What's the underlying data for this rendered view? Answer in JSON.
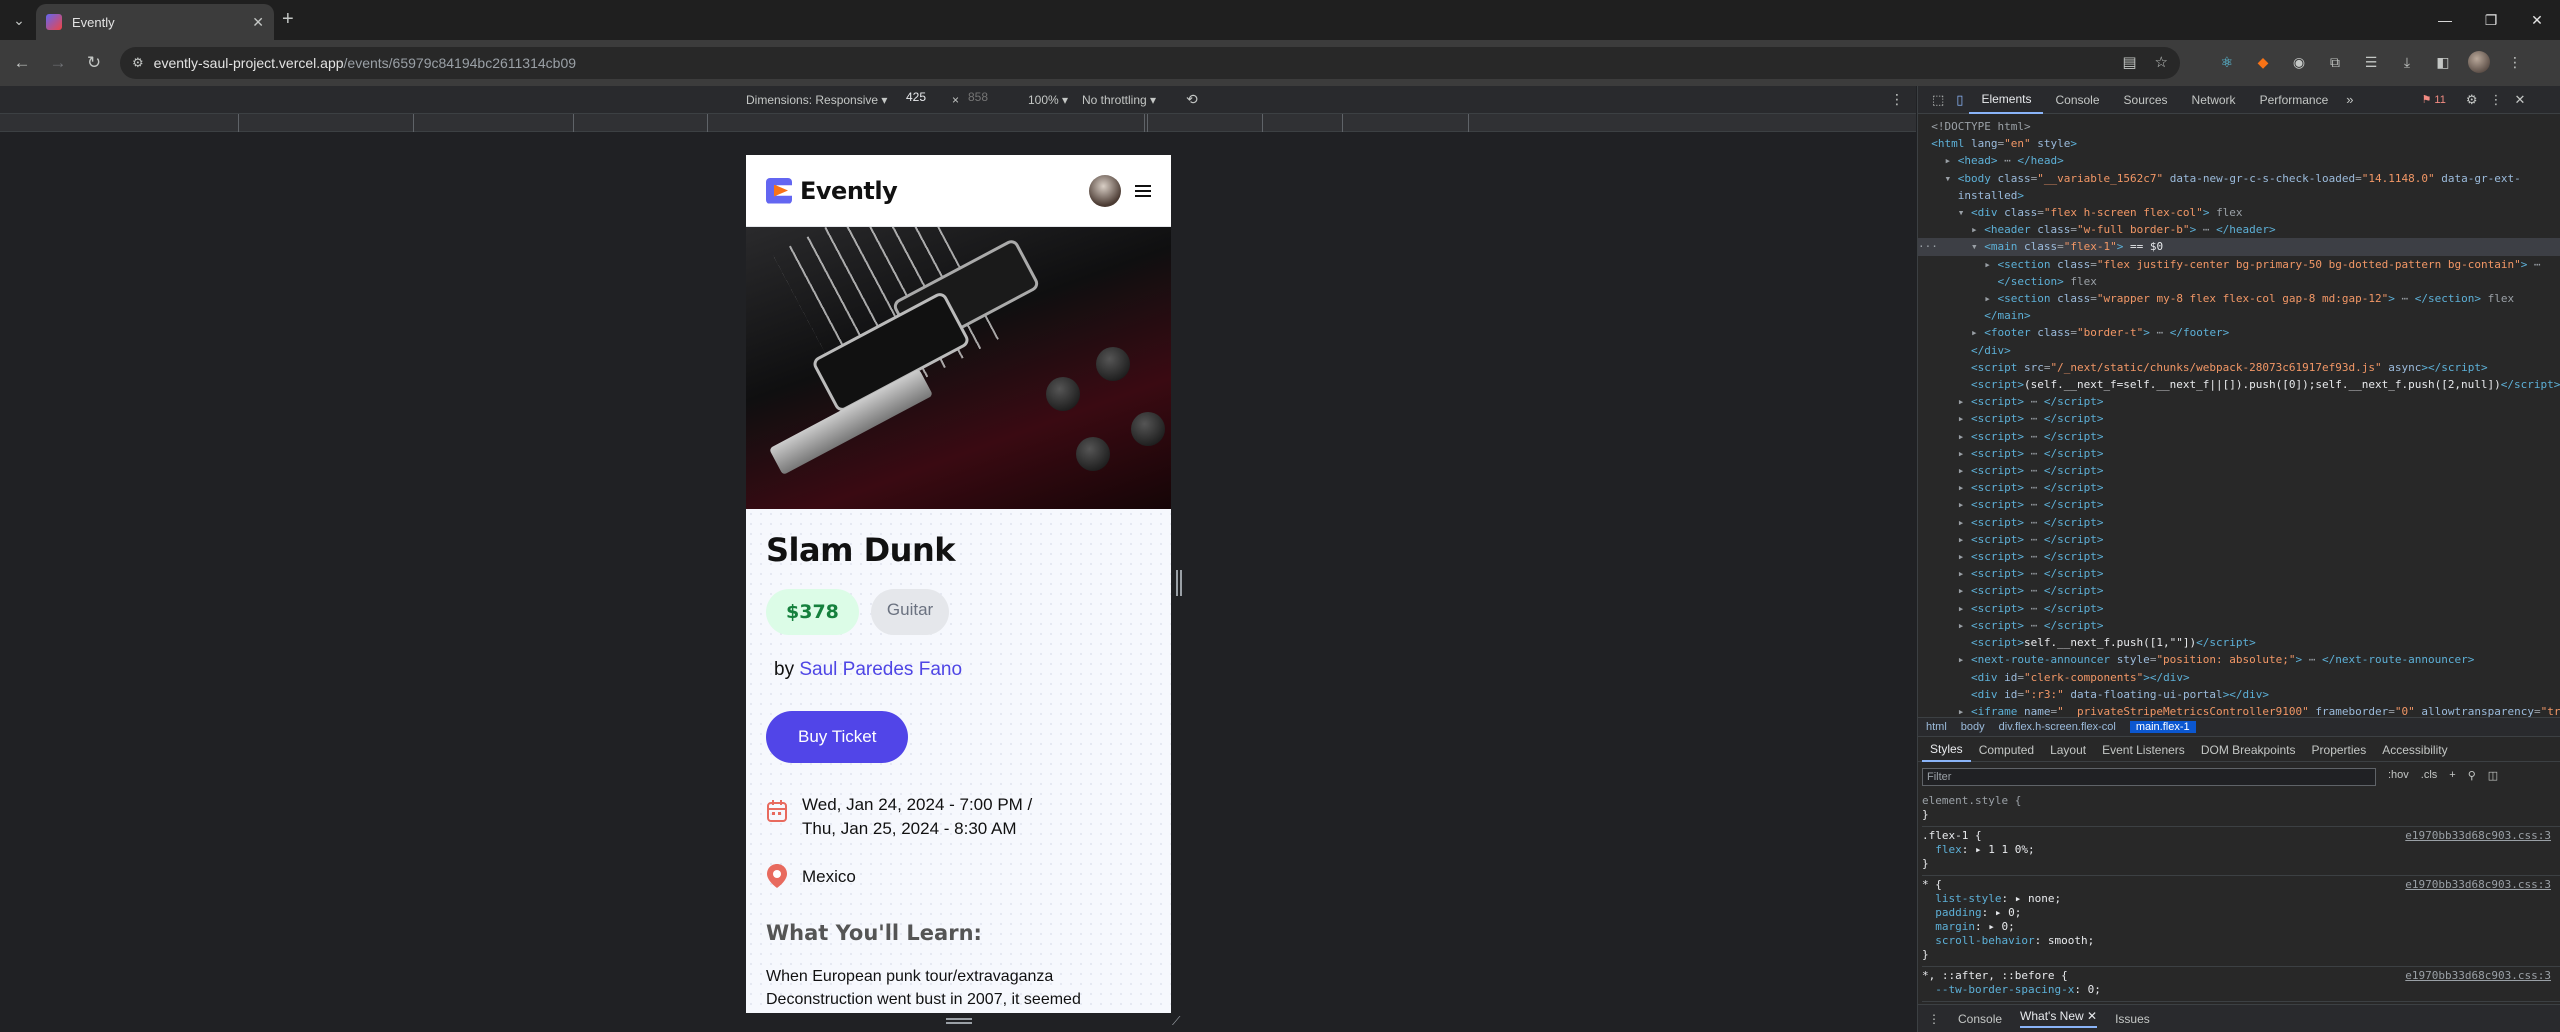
{
  "browser": {
    "tab_title": "Evently",
    "tab_close": "✕",
    "new_tab": "+",
    "url_host": "evently-saul-project.vercel.app",
    "url_path": "/events/65979c84194bc2611314cb09"
  },
  "device_toolbar": {
    "dimensions_label": "Dimensions: Responsive",
    "width": "425",
    "times": "×",
    "height_placeholder": "858",
    "zoom": "100%",
    "throttling": "No throttling"
  },
  "page": {
    "brand": "Evently",
    "event_title": "Slam Dunk",
    "price": "$378",
    "category": "Guitar",
    "by_label": "by",
    "organizer": "Saul Paredes Fano",
    "buy_button": "Buy Ticket",
    "date_line1": "Wed, Jan 24, 2024 - 7:00 PM /",
    "date_line2": "Thu, Jan 25, 2024 - 8:30 AM",
    "location": "Mexico",
    "learn_heading": "What You'll Learn:",
    "description": "When European punk tour/extravaganza Deconstruction went bust in 2007, it seemed"
  },
  "devtools": {
    "tabs": [
      "Elements",
      "Console",
      "Sources",
      "Network",
      "Performance"
    ],
    "issues_count": "11",
    "breadcrumbs": [
      "html",
      "body",
      "div.flex.h-screen.flex-col",
      "main.flex-1"
    ],
    "style_tabs": [
      "Styles",
      "Computed",
      "Layout",
      "Event Listeners",
      "DOM Breakpoints",
      "Properties",
      "Accessibility"
    ],
    "filter_placeholder": "Filter",
    "filter_hov": ":hov",
    "filter_cls": ".cls",
    "drawer_tabs": [
      "Console",
      "What's New",
      "Issues"
    ],
    "style_source": "e1970bb33d68c903.css:3"
  }
}
